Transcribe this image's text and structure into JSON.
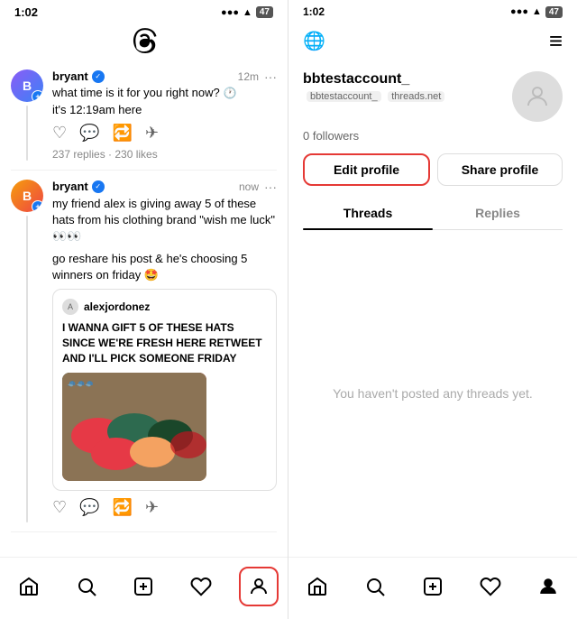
{
  "left": {
    "status_bar": {
      "time": "1:02",
      "icons": "●●● ▲ 47"
    },
    "posts": [
      {
        "username": "bryant",
        "verified": true,
        "time": "12m",
        "question": "what time is it for you right now?",
        "reply": "it's 12:19am here",
        "replies": "237 replies · 230 likes"
      },
      {
        "username": "bryant",
        "verified": true,
        "time": "now",
        "text1": "my friend alex is giving away 5 of these hats from his clothing brand \"wish me luck\" 👀👀",
        "text2": "go reshare his post & he's choosing 5 winners on friday 🤩",
        "repost": {
          "username": "alexjordonez",
          "text": "I WANNA GIFT 5 OF THESE HATS SINCE WE'RE FRESH HERE RETWEET AND I'LL PICK SOMEONE FRIDAY"
        }
      }
    ],
    "nav": {
      "home": "🏠",
      "search": "🔍",
      "compose": "✏️",
      "heart": "♡",
      "profile": "👤"
    }
  },
  "right": {
    "status_bar": {
      "time": "1:02",
      "icons": "●●● ▲ 47"
    },
    "profile": {
      "username": "bbtestaccount_",
      "handle": "bbtestaccount_",
      "domain": "threads.net",
      "followers": "0 followers",
      "edit_label": "Edit profile",
      "share_label": "Share profile",
      "tabs": [
        "Threads",
        "Replies"
      ],
      "active_tab": "Threads",
      "no_posts_text": "You haven't posted any threads yet."
    },
    "nav": {
      "home": "🏠",
      "search": "🔍",
      "compose": "✏️",
      "heart": "♡",
      "profile": "👤"
    }
  }
}
